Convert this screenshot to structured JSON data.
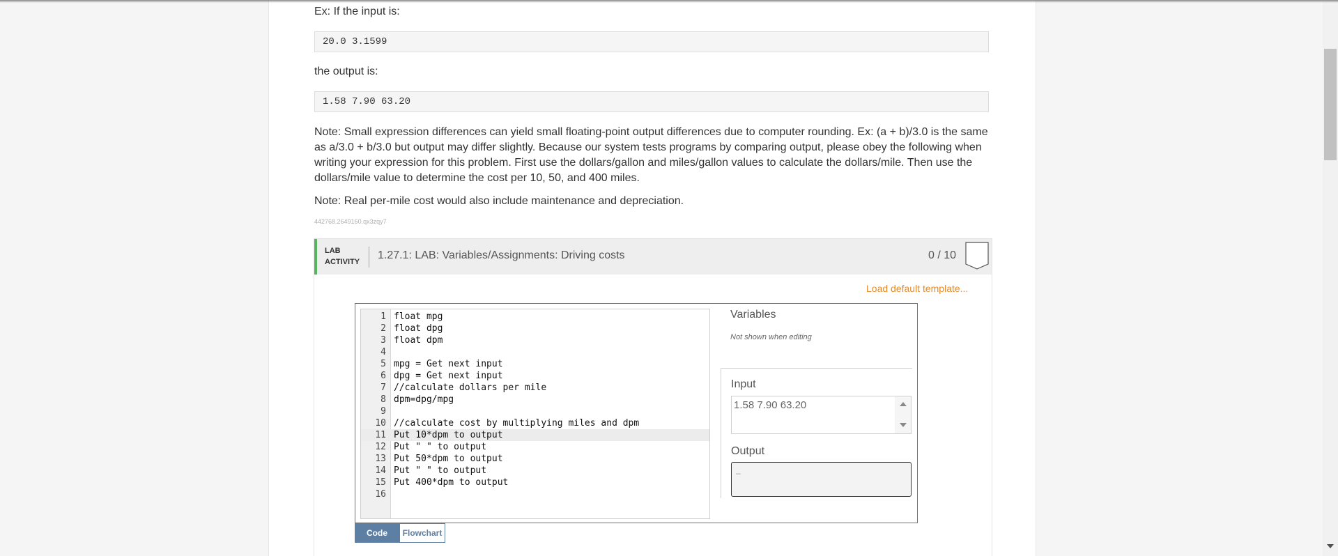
{
  "description": {
    "example_intro": "Ex: If the input is:",
    "example_input": "20.0 3.1599",
    "output_intro": "the output is:",
    "example_output": "1.58 7.90 63.20",
    "note1": "Note: Small expression differences can yield small floating-point output differences due to computer rounding. Ex: (a + b)/3.0 is the same as a/3.0 + b/3.0 but output may differ slightly. Because our system tests programs by comparing output, please obey the following when writing your expression for this problem. First use the dollars/gallon and miles/gallon values to calculate the dollars/mile. Then use the dollars/mile value to determine the cost per 10, 50, and 400 miles.",
    "note2": "Note: Real per-mile cost would also include maintenance and depreciation.",
    "activity_id": "442768.2649160.qx3zqy7"
  },
  "lab": {
    "tag_line1": "LAB",
    "tag_line2": "ACTIVITY",
    "title": "1.27.1: LAB: Variables/Assignments: Driving costs",
    "score": "0 / 10",
    "load_template": "Load default template...",
    "code_lines": [
      {
        "n": "1",
        "text": "float mpg"
      },
      {
        "n": "2",
        "text": "float dpg"
      },
      {
        "n": "3",
        "text": "float dpm"
      },
      {
        "n": "4",
        "text": ""
      },
      {
        "n": "5",
        "text": "mpg = Get next input"
      },
      {
        "n": "6",
        "text": "dpg = Get next input"
      },
      {
        "n": "7",
        "text": "//calculate dollars per mile"
      },
      {
        "n": "8",
        "text": "dpm=dpg/mpg"
      },
      {
        "n": "9",
        "text": ""
      },
      {
        "n": "10",
        "text": "//calculate cost by multiplying miles and dpm"
      },
      {
        "n": "11",
        "text": "Put 10*dpm to output"
      },
      {
        "n": "12",
        "text": "Put \" \" to output"
      },
      {
        "n": "13",
        "text": "Put 50*dpm to output"
      },
      {
        "n": "14",
        "text": "Put \" \" to output"
      },
      {
        "n": "15",
        "text": "Put 400*dpm to output"
      },
      {
        "n": "16",
        "text": ""
      }
    ],
    "active_line": 11,
    "variables_title": "Variables",
    "variables_note": "Not shown when editing",
    "input_label": "Input",
    "input_value": "1.58 7.90 63.20",
    "output_label": "Output",
    "output_value": "–",
    "tab_code": "Code",
    "tab_flowchart": "Flowchart",
    "active_tab": "Code"
  },
  "colors": {
    "accent_green": "#56b45f",
    "template_link": "#e88a20",
    "tab_blue": "#5d7fa3"
  }
}
